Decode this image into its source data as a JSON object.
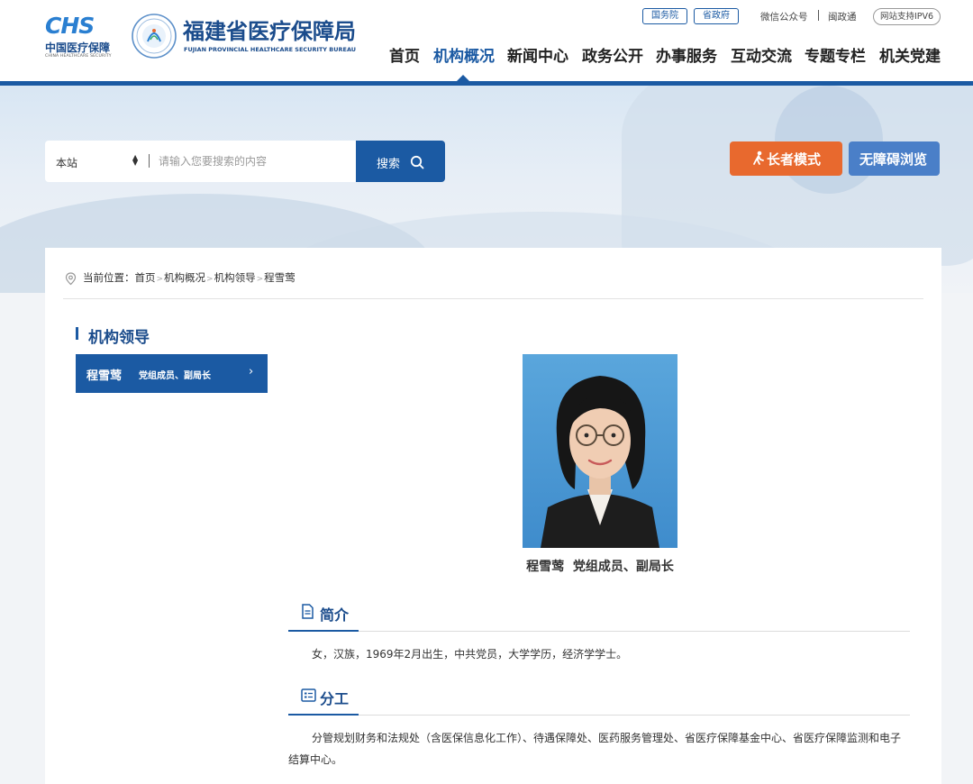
{
  "brand": {
    "chs_mark": "CHS",
    "chs_cn": "中国医疗保障",
    "chs_en": "CHINA HEALTHCARE SECURITY",
    "bureau_cn": "福建省医疗保障局",
    "bureau_en": "FUJIAN PROVINCIAL HEALTHCARE SECURITY BUREAU"
  },
  "top_links": {
    "state_council": "国务院",
    "provincial_gov": "省政府",
    "wechat": "微信公众号",
    "minzhengtong": "闽政通",
    "ipv6": "网站支持IPV6"
  },
  "nav": {
    "items": [
      "首页",
      "机构概况",
      "新闻中心",
      "政务公开",
      "办事服务",
      "互动交流",
      "专题专栏",
      "机关党建"
    ],
    "active_index": 1
  },
  "search": {
    "scope": "本站",
    "placeholder": "请输入您要搜索的内容",
    "button": "搜索"
  },
  "modes": {
    "elder": "长者模式",
    "accessible": "无障碍浏览"
  },
  "breadcrumb": {
    "label": "当前位置：",
    "items": [
      "首页",
      "机构概况",
      "机构领导",
      "程雪莺"
    ],
    "separator": ">"
  },
  "sidebar": {
    "title": "机构领导",
    "items": [
      {
        "name": "程雪莺",
        "position": "党组成员、副局长"
      }
    ]
  },
  "profile": {
    "name": "程雪莺",
    "position": "党组成员、副局长",
    "intro_title": "简介",
    "intro": "女，汉族，1969年2月出生，中共党员，大学学历，经济学学士。",
    "duty_title": "分工",
    "duty": "分管规划财务和法规处（含医保信息化工作）、待遇保障处、医药服务管理处、省医疗保障基金中心、省医疗保障监测和电子结算中心。"
  },
  "colors": {
    "primary": "#1b5aa3",
    "elder_orange": "#e8692e",
    "accessible_blue": "#4a7fc8"
  }
}
